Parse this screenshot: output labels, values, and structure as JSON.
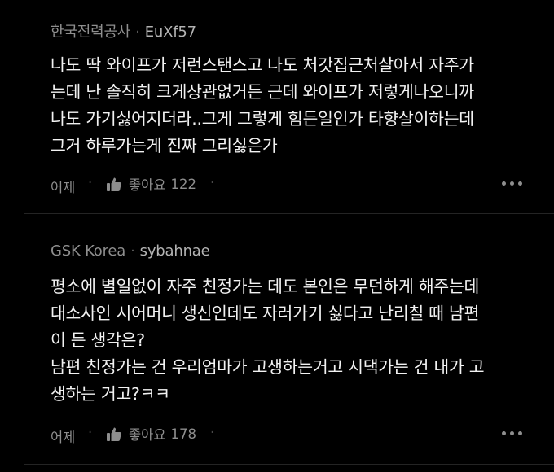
{
  "comments": [
    {
      "company": "한국전력공사",
      "separator": "·",
      "username": "EuXf57",
      "lines": [
        "나도 딱 와이프가 저런스탠스고 나도 처갓집근처살아서 자주가",
        "는데 난 솔직히 크게상관없거든 근데 와이프가 저렇게나오니까",
        "나도 가기싫어지더라..그게 그렇게 힘든일인가 타향살이하는데",
        "그거 하루가는게 진짜 그리싫은가"
      ],
      "time": "어제",
      "dot": "·",
      "like_label": "좋아요",
      "like_count": "122"
    },
    {
      "company": "GSK Korea",
      "separator": "·",
      "username": "sybahnae",
      "lines": [
        "평소에 별일없이 자주 친정가는 데도 본인은 무던하게 해주는데",
        "대소사인 시어머니 생신인데도 자러가기 싫다고 난리칠 때 남편",
        "이 든 생각은?",
        "남편 친정가는 건 우리엄마가 고생하는거고 시댁가는 건 내가 고",
        "생하는 거고?ㅋㅋ"
      ],
      "time": "어제",
      "dot": "·",
      "like_label": "좋아요",
      "like_count": "178"
    }
  ],
  "icons": {
    "like": "thumbs-up-icon",
    "more": "more-horizontal-icon"
  },
  "colors": {
    "background": "#000000",
    "text": "#f2f2f2",
    "meta": "#8e8e8e",
    "divider": "#242424"
  }
}
